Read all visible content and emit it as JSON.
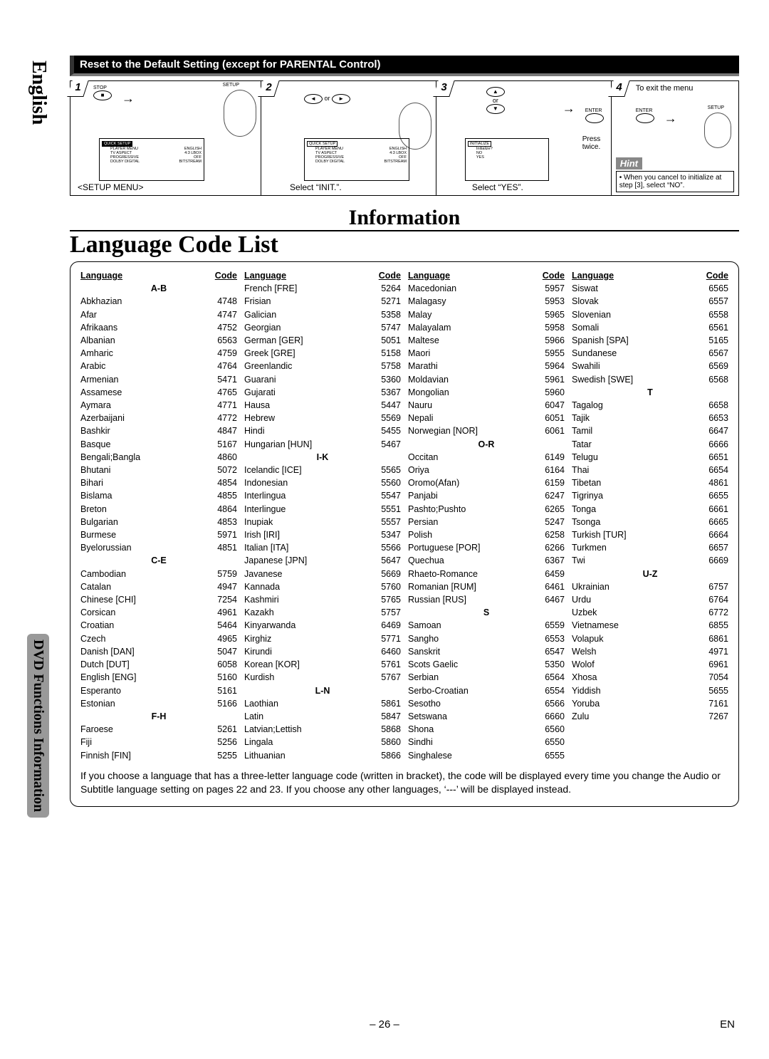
{
  "side_tabs": {
    "english": "English",
    "section": "DVD Functions  Information"
  },
  "bar_title": "Reset to the Default Setting (except for PARENTAL Control)",
  "steps": {
    "s1": {
      "num": "1",
      "caption": "<SETUP MENU>",
      "stop": "STOP",
      "setup": "SETUP"
    },
    "s2": {
      "num": "2",
      "caption": "Select “INIT.”.",
      "or": "or"
    },
    "s3": {
      "num": "3",
      "caption": "Select “YES”.",
      "or": "or",
      "enter": "ENTER",
      "press": "Press twice."
    },
    "s4": {
      "num": "4",
      "caption": "To exit the menu",
      "setup": "SETUP",
      "enter": "ENTER"
    },
    "hint_label": "Hint",
    "hint_text": "• When you cancel to initialize at step [3], select “NO”."
  },
  "mini_menu": {
    "qs": "QUICK SETUP",
    "rows": [
      {
        "l": "PLAYER MENU",
        "r": "ENGLISH"
      },
      {
        "l": "TV ASPECT",
        "r": "4:3 LBOX"
      },
      {
        "l": "PROGRESSIVE",
        "r": "OFF"
      },
      {
        "l": "DOLBY DIGITAL",
        "r": "BITSTREAM"
      }
    ],
    "init": "INITIALIZE",
    "init_rows": [
      {
        "l": "Initialize?",
        "r": ""
      },
      {
        "l": "NO",
        "r": ""
      },
      {
        "l": "YES",
        "r": ""
      }
    ]
  },
  "headings": {
    "information": "Information",
    "langlist": "Language Code List"
  },
  "col_headers": {
    "lang": "Language",
    "code": "Code"
  },
  "groups": {
    "ab": "A-B",
    "ce": "C-E",
    "fh": "F-H",
    "ik": "I-K",
    "ln": "L-N",
    "or": "O-R",
    "s": "S",
    "t": "T",
    "uz": "U-Z"
  },
  "col1": [
    {
      "l": "Abkhazian",
      "c": "4748"
    },
    {
      "l": "Afar",
      "c": "4747"
    },
    {
      "l": "Afrikaans",
      "c": "4752"
    },
    {
      "l": "Albanian",
      "c": "6563"
    },
    {
      "l": "Amharic",
      "c": "4759"
    },
    {
      "l": "Arabic",
      "c": "4764"
    },
    {
      "l": "Armenian",
      "c": "5471"
    },
    {
      "l": "Assamese",
      "c": "4765"
    },
    {
      "l": "Aymara",
      "c": "4771"
    },
    {
      "l": "Azerbaijani",
      "c": "4772"
    },
    {
      "l": "Bashkir",
      "c": "4847"
    },
    {
      "l": "Basque",
      "c": "5167"
    },
    {
      "l": "Bengali;Bangla",
      "c": "4860"
    },
    {
      "l": "Bhutani",
      "c": "5072"
    },
    {
      "l": "Bihari",
      "c": "4854"
    },
    {
      "l": "Bislama",
      "c": "4855"
    },
    {
      "l": "Breton",
      "c": "4864"
    },
    {
      "l": "Bulgarian",
      "c": "4853"
    },
    {
      "l": "Burmese",
      "c": "5971"
    },
    {
      "l": "Byelorussian",
      "c": "4851"
    }
  ],
  "col1b": [
    {
      "l": "Cambodian",
      "c": "5759"
    },
    {
      "l": "Catalan",
      "c": "4947"
    },
    {
      "l": "Chinese [CHI]",
      "c": "7254"
    },
    {
      "l": "Corsican",
      "c": "4961"
    },
    {
      "l": "Croatian",
      "c": "5464"
    },
    {
      "l": "Czech",
      "c": "4965"
    },
    {
      "l": "Danish [DAN]",
      "c": "5047"
    },
    {
      "l": "Dutch [DUT]",
      "c": "6058"
    },
    {
      "l": "English [ENG]",
      "c": "5160"
    },
    {
      "l": "Esperanto",
      "c": "5161"
    },
    {
      "l": "Estonian",
      "c": "5166"
    }
  ],
  "col1c": [
    {
      "l": "Faroese",
      "c": "5261"
    },
    {
      "l": "Fiji",
      "c": "5256"
    },
    {
      "l": "Finnish [FIN]",
      "c": "5255"
    }
  ],
  "col2": [
    {
      "l": "French [FRE]",
      "c": "5264"
    },
    {
      "l": "Frisian",
      "c": "5271"
    },
    {
      "l": "Galician",
      "c": "5358"
    },
    {
      "l": "Georgian",
      "c": "5747"
    },
    {
      "l": "German [GER]",
      "c": "5051"
    },
    {
      "l": "Greek [GRE]",
      "c": "5158"
    },
    {
      "l": "Greenlandic",
      "c": "5758"
    },
    {
      "l": "Guarani",
      "c": "5360"
    },
    {
      "l": "Gujarati",
      "c": "5367"
    },
    {
      "l": "Hausa",
      "c": "5447"
    },
    {
      "l": "Hebrew",
      "c": "5569"
    },
    {
      "l": "Hindi",
      "c": "5455"
    },
    {
      "l": "Hungarian [HUN]",
      "c": "5467"
    }
  ],
  "col2b": [
    {
      "l": "Icelandic [ICE]",
      "c": "5565"
    },
    {
      "l": "Indonesian",
      "c": "5560"
    },
    {
      "l": "Interlingua",
      "c": "5547"
    },
    {
      "l": "Interlingue",
      "c": "5551"
    },
    {
      "l": "Inupiak",
      "c": "5557"
    },
    {
      "l": "Irish [IRI]",
      "c": "5347"
    },
    {
      "l": "Italian [ITA]",
      "c": "5566"
    },
    {
      "l": "Japanese [JPN]",
      "c": "5647"
    },
    {
      "l": "Javanese",
      "c": "5669"
    },
    {
      "l": "Kannada",
      "c": "5760"
    },
    {
      "l": "Kashmiri",
      "c": "5765"
    },
    {
      "l": "Kazakh",
      "c": "5757"
    },
    {
      "l": "Kinyarwanda",
      "c": "6469"
    },
    {
      "l": "Kirghiz",
      "c": "5771"
    },
    {
      "l": "Kirundi",
      "c": "6460"
    },
    {
      "l": "Korean [KOR]",
      "c": "5761"
    },
    {
      "l": "Kurdish",
      "c": "5767"
    }
  ],
  "col2c": [
    {
      "l": "Laothian",
      "c": "5861"
    },
    {
      "l": "Latin",
      "c": "5847"
    },
    {
      "l": "Latvian;Lettish",
      "c": "5868"
    },
    {
      "l": "Lingala",
      "c": "5860"
    },
    {
      "l": "Lithuanian",
      "c": "5866"
    }
  ],
  "col3": [
    {
      "l": "Macedonian",
      "c": "5957"
    },
    {
      "l": "Malagasy",
      "c": "5953"
    },
    {
      "l": "Malay",
      "c": "5965"
    },
    {
      "l": "Malayalam",
      "c": "5958"
    },
    {
      "l": "Maltese",
      "c": "5966"
    },
    {
      "l": "Maori",
      "c": "5955"
    },
    {
      "l": "Marathi",
      "c": "5964"
    },
    {
      "l": "Moldavian",
      "c": "5961"
    },
    {
      "l": "Mongolian",
      "c": "5960"
    },
    {
      "l": "Nauru",
      "c": "6047"
    },
    {
      "l": "Nepali",
      "c": "6051"
    },
    {
      "l": "Norwegian [NOR]",
      "c": "6061"
    }
  ],
  "col3b": [
    {
      "l": "Occitan",
      "c": "6149"
    },
    {
      "l": "Oriya",
      "c": "6164"
    },
    {
      "l": "Oromo(Afan)",
      "c": "6159"
    },
    {
      "l": "Panjabi",
      "c": "6247"
    },
    {
      "l": "Pashto;Pushto",
      "c": "6265"
    },
    {
      "l": "Persian",
      "c": "5247"
    },
    {
      "l": "Polish",
      "c": "6258"
    },
    {
      "l": "Portuguese [POR]",
      "c": "6266"
    },
    {
      "l": "Quechua",
      "c": "6367"
    },
    {
      "l": "Rhaeto-Romance",
      "c": "6459"
    },
    {
      "l": "Romanian [RUM]",
      "c": "6461"
    },
    {
      "l": "Russian [RUS]",
      "c": "6467"
    }
  ],
  "col3c": [
    {
      "l": "Samoan",
      "c": "6559"
    },
    {
      "l": "Sangho",
      "c": "6553"
    },
    {
      "l": "Sanskrit",
      "c": "6547"
    },
    {
      "l": "Scots Gaelic",
      "c": "5350"
    },
    {
      "l": "Serbian",
      "c": "6564"
    },
    {
      "l": "Serbo-Croatian",
      "c": "6554"
    },
    {
      "l": "Sesotho",
      "c": "6566"
    },
    {
      "l": "Setswana",
      "c": "6660"
    },
    {
      "l": "Shona",
      "c": "6560"
    },
    {
      "l": "Sindhi",
      "c": "6550"
    },
    {
      "l": "Singhalese",
      "c": "6555"
    }
  ],
  "col4": [
    {
      "l": "Siswat",
      "c": "6565"
    },
    {
      "l": "Slovak",
      "c": "6557"
    },
    {
      "l": "Slovenian",
      "c": "6558"
    },
    {
      "l": "Somali",
      "c": "6561"
    },
    {
      "l": "Spanish [SPA]",
      "c": "5165"
    },
    {
      "l": "Sundanese",
      "c": "6567"
    },
    {
      "l": "Swahili",
      "c": "6569"
    },
    {
      "l": "Swedish [SWE]",
      "c": "6568"
    }
  ],
  "col4b": [
    {
      "l": "Tagalog",
      "c": "6658"
    },
    {
      "l": "Tajik",
      "c": "6653"
    },
    {
      "l": "Tamil",
      "c": "6647"
    },
    {
      "l": "Tatar",
      "c": "6666"
    },
    {
      "l": "Telugu",
      "c": "6651"
    },
    {
      "l": "Thai",
      "c": "6654"
    },
    {
      "l": "Tibetan",
      "c": "4861"
    },
    {
      "l": "Tigrinya",
      "c": "6655"
    },
    {
      "l": "Tonga",
      "c": "6661"
    },
    {
      "l": "Tsonga",
      "c": "6665"
    },
    {
      "l": "Turkish [TUR]",
      "c": "6664"
    },
    {
      "l": "Turkmen",
      "c": "6657"
    },
    {
      "l": "Twi",
      "c": "6669"
    }
  ],
  "col4c": [
    {
      "l": "Ukrainian",
      "c": "6757"
    },
    {
      "l": "Urdu",
      "c": "6764"
    },
    {
      "l": "Uzbek",
      "c": "6772"
    },
    {
      "l": "Vietnamese",
      "c": "6855"
    },
    {
      "l": "Volapuk",
      "c": "6861"
    },
    {
      "l": "Welsh",
      "c": "4971"
    },
    {
      "l": "Wolof",
      "c": "6961"
    },
    {
      "l": "Xhosa",
      "c": "7054"
    },
    {
      "l": "Yiddish",
      "c": "5655"
    },
    {
      "l": "Yoruba",
      "c": "7161"
    },
    {
      "l": "Zulu",
      "c": "7267"
    }
  ],
  "note": "If you choose a language that has a three-letter language code (written in bracket), the code will be displayed every time you change the Audio or Subtitle language setting on pages 22 and 23. If you choose any other languages, ‘---’ will be displayed instead.",
  "footer": {
    "page": "– 26 –",
    "en": "EN"
  }
}
